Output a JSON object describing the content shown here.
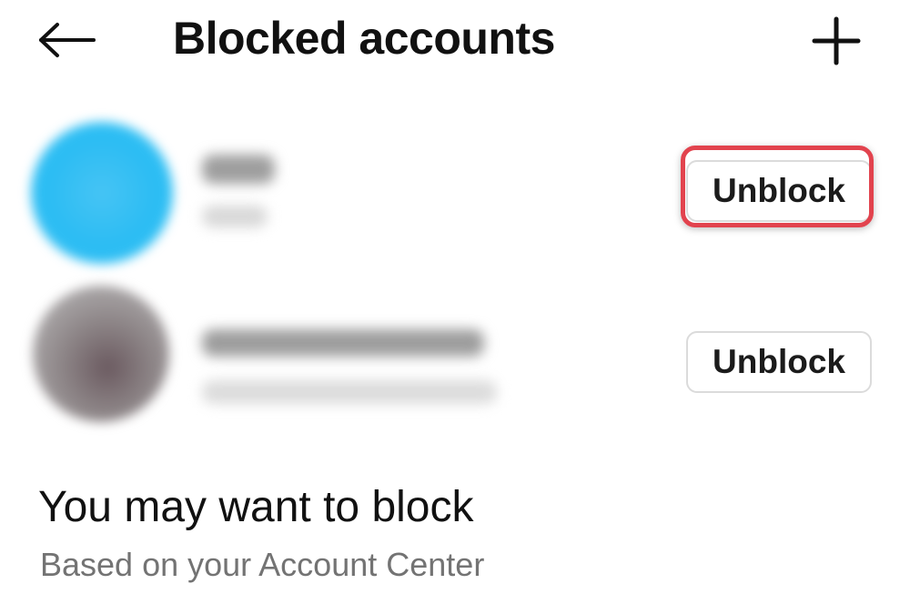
{
  "header": {
    "back_icon": "arrow-left-icon",
    "title": "Blocked accounts",
    "add_icon": "plus-icon"
  },
  "blocked_accounts": [
    {
      "name": "",
      "subtitle": "",
      "avatar_color": "#2bbcf3",
      "button_label": "Unblock",
      "highlighted": true
    },
    {
      "name": "",
      "subtitle": "",
      "avatar_color": "#8c8486",
      "button_label": "Unblock",
      "highlighted": false
    }
  ],
  "suggestions": {
    "title": "You may want to block",
    "subtitle": "Based on your Account Center"
  },
  "colors": {
    "highlight": "#e2434e",
    "button_border": "#dbdbdb",
    "secondary_text": "#737373"
  }
}
